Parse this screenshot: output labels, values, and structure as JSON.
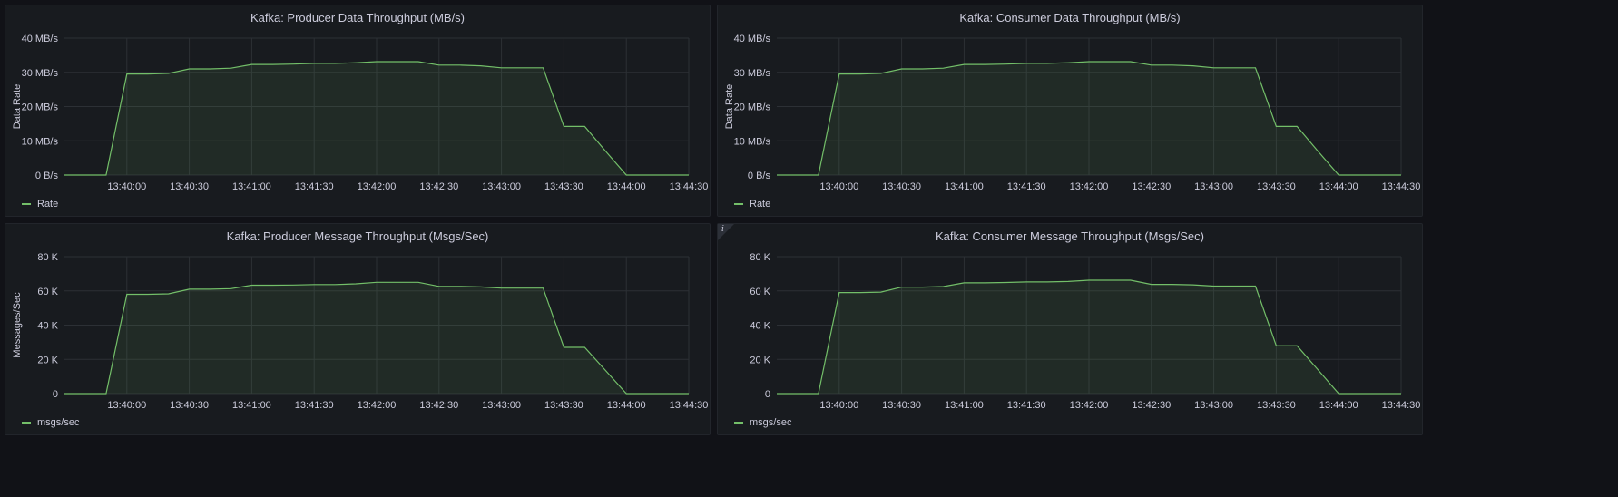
{
  "dashboard": {
    "line_color": "#73bf69",
    "fill_color": "rgba(115,191,105,0.10)",
    "grid_color": "#2c3035",
    "text_color": "#ccccdc",
    "panel_bg": "#181b1f"
  },
  "x_ticks": [
    "13:40:00",
    "13:40:30",
    "13:41:00",
    "13:41:30",
    "13:42:00",
    "13:42:30",
    "13:43:00",
    "13:43:30",
    "13:44:00",
    "13:44:30"
  ],
  "panels": [
    {
      "title": "Kafka: Producer Data Throughput (MB/s)",
      "ylabel": "Data Rate",
      "legend": "Rate",
      "y_ticks": [
        "0 B/s",
        "10 MB/s",
        "20 MB/s",
        "30 MB/s",
        "40 MB/s"
      ],
      "info_icon": "",
      "chart_data": {
        "type": "area",
        "x": [
          "13:39:30",
          "13:39:40",
          "13:39:50",
          "13:40:00",
          "13:40:10",
          "13:40:20",
          "13:40:30",
          "13:40:40",
          "13:40:50",
          "13:41:00",
          "13:41:10",
          "13:41:20",
          "13:41:30",
          "13:41:40",
          "13:41:50",
          "13:42:00",
          "13:42:10",
          "13:42:20",
          "13:42:30",
          "13:42:40",
          "13:42:50",
          "13:43:00",
          "13:43:10",
          "13:43:20",
          "13:43:30",
          "13:43:40",
          "13:43:50",
          "13:44:00",
          "13:44:10",
          "13:44:20",
          "13:44:30"
        ],
        "series": [
          {
            "name": "Rate",
            "unit": "MB/s",
            "values": [
              0,
              0,
              0,
              29.5,
              29.5,
              29.7,
              31,
              31,
              31.2,
              32.3,
              32.3,
              32.4,
              32.6,
              32.6,
              32.8,
              33.1,
              33.1,
              33.1,
              32.1,
              32.1,
              31.9,
              31.3,
              31.3,
              31.3,
              14.2,
              14.2,
              7,
              0,
              0,
              0,
              0
            ]
          }
        ],
        "ylim": [
          0,
          40
        ],
        "grid": true,
        "legend_placement": "bottom-left"
      }
    },
    {
      "title": "Kafka: Consumer Data Throughput (MB/s)",
      "ylabel": "Data Rate",
      "legend": "Rate",
      "y_ticks": [
        "0 B/s",
        "10 MB/s",
        "20 MB/s",
        "30 MB/s",
        "40 MB/s"
      ],
      "info_icon": "",
      "chart_data": {
        "type": "area",
        "x": [
          "13:39:30",
          "13:39:40",
          "13:39:50",
          "13:40:00",
          "13:40:10",
          "13:40:20",
          "13:40:30",
          "13:40:40",
          "13:40:50",
          "13:41:00",
          "13:41:10",
          "13:41:20",
          "13:41:30",
          "13:41:40",
          "13:41:50",
          "13:42:00",
          "13:42:10",
          "13:42:20",
          "13:42:30",
          "13:42:40",
          "13:42:50",
          "13:43:00",
          "13:43:10",
          "13:43:20",
          "13:43:30",
          "13:43:40",
          "13:43:50",
          "13:44:00",
          "13:44:10",
          "13:44:20",
          "13:44:30"
        ],
        "series": [
          {
            "name": "Rate",
            "unit": "MB/s",
            "values": [
              0,
              0,
              0,
              29.5,
              29.5,
              29.7,
              31,
              31,
              31.2,
              32.3,
              32.3,
              32.4,
              32.6,
              32.6,
              32.8,
              33.1,
              33.1,
              33.1,
              32.1,
              32.1,
              31.9,
              31.3,
              31.3,
              31.3,
              14.2,
              14.2,
              7,
              0,
              0,
              0,
              0
            ]
          }
        ],
        "ylim": [
          0,
          40
        ],
        "grid": true,
        "legend_placement": "bottom-left"
      }
    },
    {
      "title": "Kafka: Producer Message Throughput (Msgs/Sec)",
      "ylabel": "Messages/Sec",
      "legend": "msgs/sec",
      "y_ticks": [
        "0",
        "20 K",
        "40 K",
        "60 K",
        "80 K"
      ],
      "info_icon": "",
      "chart_data": {
        "type": "area",
        "x": [
          "13:39:30",
          "13:39:40",
          "13:39:50",
          "13:40:00",
          "13:40:10",
          "13:40:20",
          "13:40:30",
          "13:40:40",
          "13:40:50",
          "13:41:00",
          "13:41:10",
          "13:41:20",
          "13:41:30",
          "13:41:40",
          "13:41:50",
          "13:42:00",
          "13:42:10",
          "13:42:20",
          "13:42:30",
          "13:42:40",
          "13:42:50",
          "13:43:00",
          "13:43:10",
          "13:43:20",
          "13:43:30",
          "13:43:40",
          "13:43:50",
          "13:44:00",
          "13:44:10",
          "13:44:20",
          "13:44:30"
        ],
        "series": [
          {
            "name": "msgs/sec",
            "unit": "msgs/sec",
            "values": [
              0,
              0,
              0,
              58000,
              58000,
              58300,
              61000,
              61000,
              61300,
              63300,
              63300,
              63400,
              63700,
              63700,
              64100,
              65000,
              65000,
              65000,
              62600,
              62600,
              62300,
              61600,
              61600,
              61600,
              27000,
              27000,
              13500,
              0,
              0,
              0,
              0
            ]
          }
        ],
        "ylim": [
          0,
          80000
        ],
        "grid": true,
        "legend_placement": "bottom-left"
      }
    },
    {
      "title": "Kafka: Consumer Message Throughput (Msgs/Sec)",
      "ylabel": "",
      "legend": "msgs/sec",
      "y_ticks": [
        "0",
        "20 K",
        "40 K",
        "60 K",
        "80 K"
      ],
      "info_icon": "i",
      "chart_data": {
        "type": "area",
        "x": [
          "13:39:30",
          "13:39:40",
          "13:39:50",
          "13:40:00",
          "13:40:10",
          "13:40:20",
          "13:40:30",
          "13:40:40",
          "13:40:50",
          "13:41:00",
          "13:41:10",
          "13:41:20",
          "13:41:30",
          "13:41:40",
          "13:41:50",
          "13:42:00",
          "13:42:10",
          "13:42:20",
          "13:42:30",
          "13:42:40",
          "13:42:50",
          "13:43:00",
          "13:43:10",
          "13:43:20",
          "13:43:30",
          "13:43:40",
          "13:43:50",
          "13:44:00",
          "13:44:10",
          "13:44:20",
          "13:44:30"
        ],
        "series": [
          {
            "name": "msgs/sec",
            "unit": "msgs/sec",
            "values": [
              0,
              0,
              0,
              59000,
              59000,
              59300,
              62200,
              62200,
              62500,
              64700,
              64700,
              64900,
              65200,
              65200,
              65500,
              66200,
              66200,
              66200,
              63800,
              63800,
              63500,
              62800,
              62800,
              62800,
              28000,
              28000,
              14000,
              0,
              0,
              0,
              0
            ]
          }
        ],
        "ylim": [
          0,
          80000
        ],
        "grid": true,
        "legend_placement": "bottom-left"
      }
    }
  ]
}
